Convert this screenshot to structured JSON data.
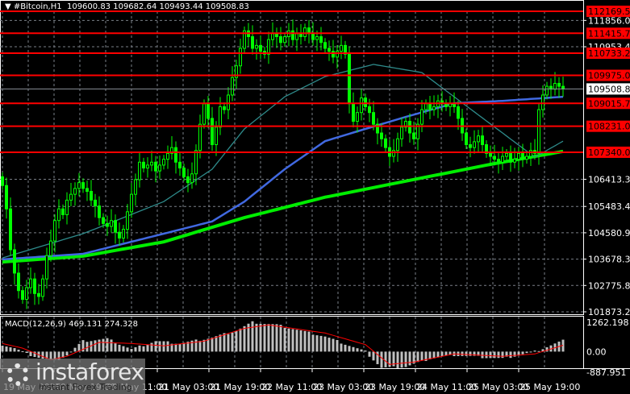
{
  "header": {
    "symbol": "#Bitcoin,H1",
    "ohlc": "109600.83 109682.64 109493.44 109508.83"
  },
  "logo": {
    "brand": "instaforex",
    "tagline": "Instant Forex Trading"
  },
  "colors": {
    "candle": "#00ff00",
    "level": "#ff0000",
    "ma_slow": "#00ee00",
    "ma_mid": "#4169e1",
    "ma_fast": "#2e8b8b",
    "macd_hist": "#c0c0c0",
    "macd_signal": "#ff0000",
    "grid": "#7a7f87"
  },
  "chart_data": [
    {
      "type": "candlestick",
      "title": "#Bitcoin,H1",
      "ylim": [
        101873.25,
        112169.53
      ],
      "y_ticks": [
        "111856.00",
        "110953.45",
        "106413.35",
        "105483.45",
        "104580.90",
        "103678.35",
        "102775.80",
        "101873.25"
      ],
      "x_tick_labels": [
        "19 May 2025",
        "19 May 19:00",
        "20 May 11:00",
        "21 May 03:00",
        "21 May 19:00",
        "22 May 11:00",
        "23 May 03:00",
        "23 May 19:00",
        "24 May 11:00",
        "25 May 03:00",
        "25 May 19:00"
      ],
      "levels": [
        "112169.53",
        "111415.71",
        "110733.27",
        "109975.01",
        "109015.70",
        "108231.00",
        "107340.03"
      ],
      "current_price": "109508.83",
      "close": [
        106200,
        105400,
        104000,
        103200,
        102600,
        102300,
        102700,
        103000,
        102500,
        102400,
        103000,
        103800,
        104300,
        105000,
        105400,
        105200,
        105700,
        105900,
        106100,
        106300,
        106100,
        106000,
        105700,
        105500,
        105100,
        104900,
        104800,
        105000,
        104600,
        104400,
        104700,
        105300,
        105900,
        106400,
        107000,
        106800,
        106900,
        107000,
        106700,
        106900,
        107100,
        107300,
        107500,
        107000,
        106800,
        106500,
        106300,
        106600,
        107400,
        108300,
        109000,
        108500,
        107600,
        108200,
        108900,
        108800,
        109300,
        109900,
        110300,
        110900,
        111500,
        111300,
        110900,
        111000,
        110800,
        110700,
        111200,
        111400,
        111300,
        111100,
        111300,
        111500,
        111200,
        111400,
        111300,
        111600,
        111400,
        111200,
        111300,
        111100,
        110900,
        110800,
        110600,
        110800,
        111000,
        110700,
        109000,
        108400,
        108700,
        109200,
        108900,
        108700,
        108300,
        108000,
        107800,
        107500,
        107200,
        107400,
        107800,
        108200,
        108400,
        108000,
        107800,
        108300,
        108800,
        109000,
        108800,
        108900,
        109100,
        109000,
        108900,
        109000,
        108900,
        108500,
        108000,
        107600,
        107500,
        107700,
        107900,
        107600,
        107300,
        107200,
        107100,
        107000,
        107200,
        107300,
        107000,
        107100,
        107300,
        107100,
        107200,
        107400,
        107300,
        108800,
        109300,
        109600,
        109500,
        109700,
        109600,
        109509
      ],
      "moving_averages": [
        {
          "name": "MA slow",
          "points": [
            [
              0,
              103580
            ],
            [
              20,
              103780
            ],
            [
              40,
              104270
            ],
            [
              60,
              105100
            ],
            [
              80,
              105800
            ],
            [
              100,
              106350
            ],
            [
              120,
              106900
            ],
            [
              139,
              107370
            ]
          ]
        },
        {
          "name": "MA mid",
          "points": [
            [
              0,
              103670
            ],
            [
              20,
              103860
            ],
            [
              40,
              104550
            ],
            [
              52,
              104970
            ],
            [
              60,
              105650
            ],
            [
              70,
              106760
            ],
            [
              80,
              107720
            ],
            [
              90,
              108140
            ],
            [
              100,
              108550
            ],
            [
              112,
              109020
            ],
            [
              124,
              109100
            ],
            [
              139,
              109240
            ]
          ]
        },
        {
          "name": "MA fast",
          "points": [
            [
              0,
              103720
            ],
            [
              20,
              104550
            ],
            [
              40,
              105650
            ],
            [
              52,
              106760
            ],
            [
              60,
              108140
            ],
            [
              70,
              109240
            ],
            [
              80,
              109930
            ],
            [
              92,
              110350
            ],
            [
              104,
              110070
            ],
            [
              112,
              109240
            ],
            [
              124,
              108000
            ],
            [
              132,
              107170
            ],
            [
              139,
              107720
            ]
          ]
        }
      ]
    },
    {
      "type": "bar",
      "title": "MACD(12,26,9) 469.131 274.328",
      "ylim": [
        -887.951,
        1262.198
      ],
      "y_ticks": [
        "1262.198",
        "0.00",
        "-887.951"
      ],
      "histogram_points": [
        [
          0,
          300
        ],
        [
          3,
          150
        ],
        [
          6,
          -100
        ],
        [
          10,
          -300
        ],
        [
          13,
          -400
        ],
        [
          16,
          -150
        ],
        [
          20,
          450
        ],
        [
          26,
          550
        ],
        [
          32,
          100
        ],
        [
          38,
          450
        ],
        [
          44,
          350
        ],
        [
          52,
          600
        ],
        [
          58,
          900
        ],
        [
          62,
          1262
        ],
        [
          68,
          1150
        ],
        [
          80,
          650
        ],
        [
          90,
          0
        ],
        [
          94,
          -700
        ],
        [
          100,
          -650
        ],
        [
          106,
          -300
        ],
        [
          112,
          -150
        ],
        [
          116,
          -200
        ],
        [
          124,
          -300
        ],
        [
          132,
          0
        ],
        [
          139,
          469
        ]
      ],
      "signal_points": [
        [
          0,
          350
        ],
        [
          5,
          150
        ],
        [
          12,
          -350
        ],
        [
          16,
          -200
        ],
        [
          24,
          400
        ],
        [
          32,
          350
        ],
        [
          40,
          250
        ],
        [
          50,
          450
        ],
        [
          60,
          1000
        ],
        [
          66,
          1150
        ],
        [
          80,
          800
        ],
        [
          90,
          300
        ],
        [
          96,
          -550
        ],
        [
          102,
          -450
        ],
        [
          112,
          -100
        ],
        [
          124,
          -200
        ],
        [
          132,
          -100
        ],
        [
          139,
          274
        ]
      ]
    }
  ]
}
